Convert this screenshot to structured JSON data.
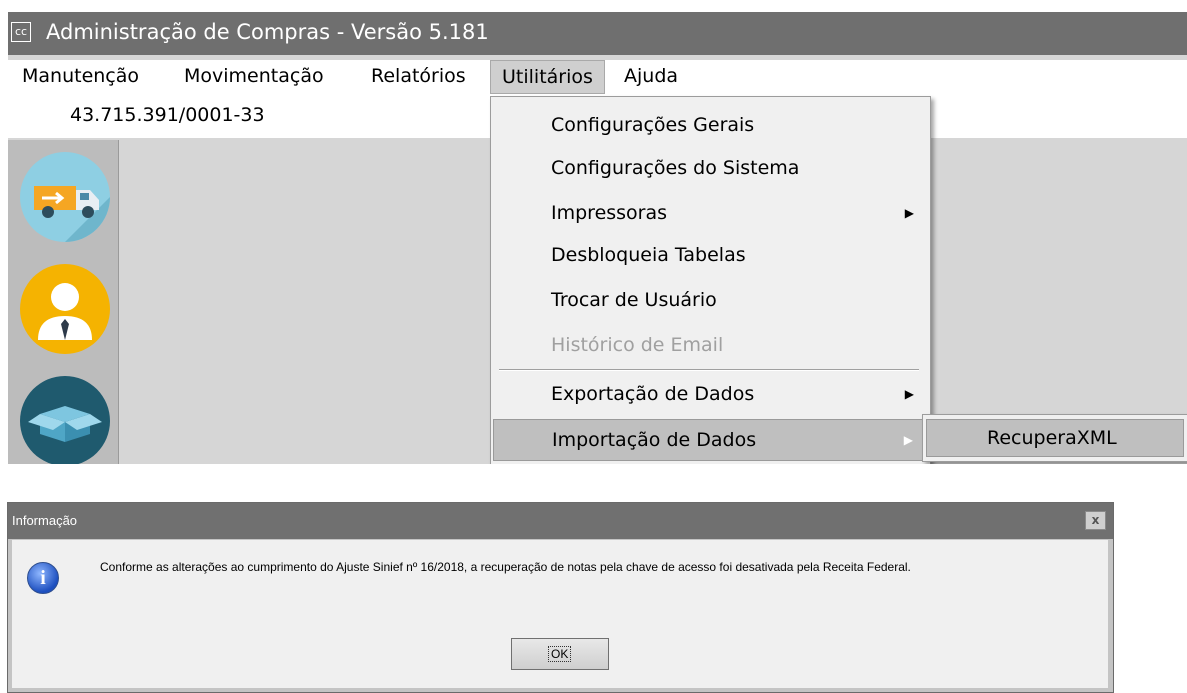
{
  "app": {
    "icon_text": "cc",
    "title": "Administração de Compras - Versão 5.181",
    "cnpj": "43.715.391/0001-33"
  },
  "menubar": {
    "items": [
      "Manutenção",
      "Movimentação",
      "Relatórios",
      "Utilitários",
      "Ajuda"
    ]
  },
  "utilities_menu": {
    "items": [
      "Configurações Gerais",
      "Configurações do Sistema",
      "Impressoras",
      "Desbloqueia Tabelas",
      "Trocar de Usuário",
      "Histórico de Email",
      "Exportação de Dados",
      "Importação de Dados"
    ],
    "submenu_item": "RecuperaXML"
  },
  "sidebar": {
    "icons": [
      "truck-icon",
      "user-icon",
      "box-icon"
    ]
  },
  "dialog": {
    "title": "Informação",
    "close": "x",
    "icon_text": "i",
    "message": "Conforme as alterações ao cumprimento do Ajuste Sinief nº 16/2018, a recuperação de notas pela chave de acesso foi desativada pela Receita Federal.",
    "ok_label": "OK"
  }
}
